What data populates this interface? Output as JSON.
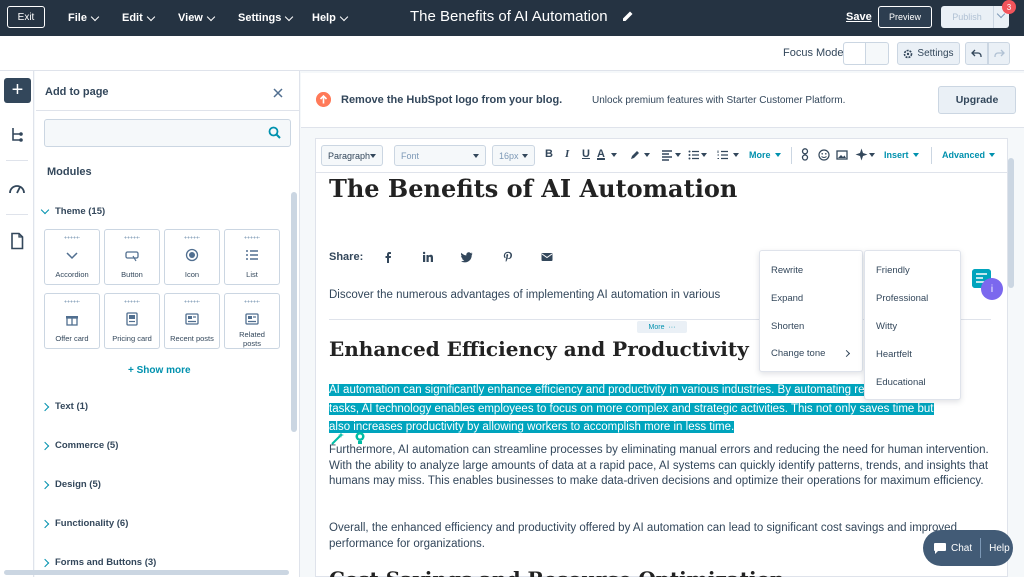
{
  "topbar": {
    "exit": "Exit",
    "menus": [
      "File",
      "Edit",
      "View",
      "Settings",
      "Help"
    ],
    "title": "The Benefits of AI Automation",
    "save": "Save",
    "preview": "Preview",
    "publish": "Publish",
    "badge": "3"
  },
  "toolbar2": {
    "focus_mode": "Focus Mode",
    "settings": "Settings"
  },
  "panel": {
    "title": "Add to page",
    "search_placeholder": "",
    "modules_label": "Modules",
    "theme_group": "Theme (15)",
    "tiles": [
      {
        "label": "Accordion",
        "icon": "chevron-down-icon"
      },
      {
        "label": "Button",
        "icon": "button-icon"
      },
      {
        "label": "Icon",
        "icon": "circle-icon"
      },
      {
        "label": "List",
        "icon": "list-icon"
      },
      {
        "label": "Offer card",
        "icon": "gift-icon"
      },
      {
        "label": "Pricing card",
        "icon": "pricing-icon"
      },
      {
        "label": "Recent posts",
        "icon": "posts-icon"
      },
      {
        "label": "Related posts",
        "icon": "related-icon"
      }
    ],
    "show_more": "Show more",
    "groups": [
      "Text (1)",
      "Commerce (5)",
      "Design (5)",
      "Functionality (6)",
      "Forms and Buttons (3)"
    ]
  },
  "banner": {
    "strong": "Remove the HubSpot logo from your blog.",
    "text": "Unlock premium features with Starter Customer Platform.",
    "upgrade": "Upgrade"
  },
  "rte": {
    "paragraph": "Paragraph",
    "font": "Font",
    "size": "16px",
    "more": "More",
    "insert": "Insert",
    "advanced": "Advanced"
  },
  "content": {
    "h1": "The Benefits of AI Automation",
    "share": "Share:",
    "intro": "Discover the numerous advantages of implementing AI automation in various",
    "more_tag": "More",
    "h2": "Enhanced Efficiency and Productivity",
    "highlight_lines": [
      "AI automation can significantly enhance efficiency and productivity in various industries. By automating repetitive",
      "tasks, AI technology enables employees to focus on more complex and strategic activities. This not only saves time but",
      "also increases productivity by allowing workers to accomplish more in less time."
    ],
    "para2": "Furthermore, AI automation can streamline processes by eliminating manual errors and reducing the need for human intervention. With the ability to analyze large amounts of data at a rapid pace, AI systems can quickly identify patterns, trends, and insights that humans may miss. This enables businesses to make data-driven decisions and optimize their operations for maximum efficiency.",
    "para3": "Overall, the enhanced efficiency and productivity offered by AI automation can lead to significant cost savings and improved performance for organizations.",
    "h2b": "Cost Savings and Resource Optimization"
  },
  "ai_menu": {
    "actions": [
      "Rewrite",
      "Expand",
      "Shorten",
      "Change tone"
    ],
    "tones": [
      "Friendly",
      "Professional",
      "Witty",
      "Heartfelt",
      "Educational"
    ]
  },
  "chat": {
    "chat": "Chat",
    "help": "Help"
  },
  "side": {
    "info": "i"
  },
  "colors": {
    "topbar": "#253342",
    "accent": "#0091ae",
    "highlight": "#00a4bd",
    "banner_icon": "#ff7a59"
  }
}
